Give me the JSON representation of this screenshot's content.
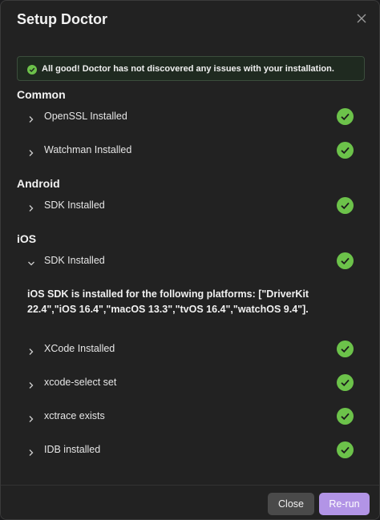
{
  "dialog": {
    "title": "Setup Doctor"
  },
  "banner": {
    "text": "All good! Doctor has not discovered any issues with your installation."
  },
  "sections": {
    "common": {
      "title": "Common",
      "items": [
        {
          "label": "OpenSSL Installed"
        },
        {
          "label": "Watchman Installed"
        }
      ]
    },
    "android": {
      "title": "Android",
      "items": [
        {
          "label": "SDK Installed"
        }
      ]
    },
    "ios": {
      "title": "iOS",
      "items": [
        {
          "label": "SDK Installed",
          "expanded": true,
          "detail": "iOS SDK is installed for the following platforms: [\"DriverKit 22.4\",\"iOS 16.4\",\"macOS 13.3\",\"tvOS 16.4\",\"watchOS 9.4\"]."
        },
        {
          "label": "XCode Installed"
        },
        {
          "label": "xcode-select set"
        },
        {
          "label": "xctrace exists"
        },
        {
          "label": "IDB installed"
        }
      ]
    }
  },
  "footer": {
    "close_label": "Close",
    "rerun_label": "Re-run"
  },
  "colors": {
    "success": "#6cc24a",
    "accent": "#b294e6"
  }
}
